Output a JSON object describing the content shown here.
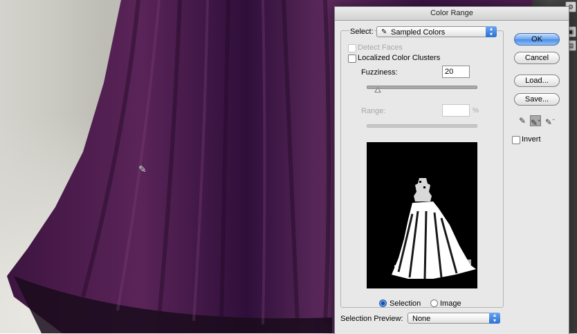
{
  "dialog": {
    "title": "Color Range",
    "select_label": "Select:",
    "select_value": "Sampled Colors",
    "detect_faces_label": "Detect Faces",
    "localized_label": "Localized Color Clusters",
    "fuzziness_label": "Fuzziness:",
    "fuzziness_value": "20",
    "range_label": "Range:",
    "range_value": "",
    "range_unit": "%",
    "fuzziness_slider_fraction": 0.1,
    "radio_selection_label": "Selection",
    "radio_image_label": "Image",
    "preview_mode_selected": "Selection",
    "selection_preview_label": "Selection Preview:",
    "selection_preview_value": "None",
    "buttons": {
      "ok": "OK",
      "cancel": "Cancel",
      "load": "Load...",
      "save": "Save..."
    },
    "invert_label": "Invert",
    "invert_checked": false,
    "localized_checked": false,
    "detect_faces_checked": false,
    "eyedroppers": [
      "eyedropper-icon",
      "eyedropper-plus-icon",
      "eyedropper-minus-icon"
    ],
    "active_eyedropper": "eyedropper-plus-icon"
  },
  "colors": {
    "accent": "#3a7ad8",
    "gown": "#4b1d4a"
  }
}
